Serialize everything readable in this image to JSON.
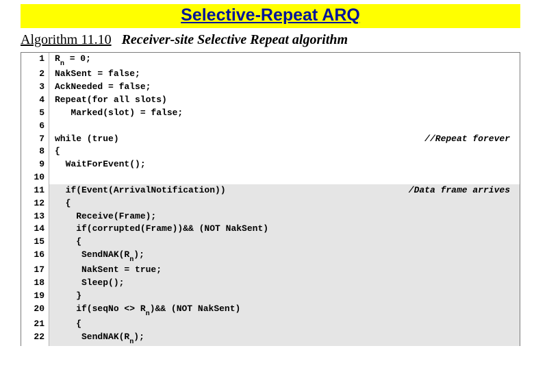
{
  "banner": {
    "title": "Selective-Repeat ARQ"
  },
  "heading": {
    "label": "Algorithm 11.10",
    "title": "Receiver-site Selective Repeat algorithm"
  },
  "code": {
    "lines": [
      {
        "n": "1",
        "bg": "a",
        "pre": "R",
        "sub": "n",
        "post": " = 0;",
        "comment": ""
      },
      {
        "n": "2",
        "bg": "a",
        "pre": "NakSent = false;",
        "sub": "",
        "post": "",
        "comment": ""
      },
      {
        "n": "3",
        "bg": "a",
        "pre": "AckNeeded = false;",
        "sub": "",
        "post": "",
        "comment": ""
      },
      {
        "n": "4",
        "bg": "a",
        "pre": "Repeat(for all slots)",
        "sub": "",
        "post": "",
        "comment": ""
      },
      {
        "n": "5",
        "bg": "a",
        "pre": "   Marked(slot) = false;",
        "sub": "",
        "post": "",
        "comment": ""
      },
      {
        "n": "6",
        "bg": "a",
        "pre": "",
        "sub": "",
        "post": "",
        "comment": ""
      },
      {
        "n": "7",
        "bg": "a",
        "pre": "while (true)",
        "sub": "",
        "post": "",
        "comment": "//Repeat forever"
      },
      {
        "n": "8",
        "bg": "a",
        "pre": "{",
        "sub": "",
        "post": "",
        "comment": ""
      },
      {
        "n": "9",
        "bg": "a",
        "pre": "  WaitForEvent();",
        "sub": "",
        "post": "",
        "comment": ""
      },
      {
        "n": "10",
        "bg": "a",
        "pre": "",
        "sub": "",
        "post": "",
        "comment": ""
      },
      {
        "n": "11",
        "bg": "b",
        "pre": "  if(Event(ArrivalNotification))",
        "sub": "",
        "post": "",
        "comment": "/Data frame arrives"
      },
      {
        "n": "12",
        "bg": "b",
        "pre": "  {",
        "sub": "",
        "post": "",
        "comment": ""
      },
      {
        "n": "13",
        "bg": "b",
        "pre": "    Receive(Frame);",
        "sub": "",
        "post": "",
        "comment": ""
      },
      {
        "n": "14",
        "bg": "b",
        "pre": "    if(corrupted(Frame))&& (NOT NakSent)",
        "sub": "",
        "post": "",
        "comment": ""
      },
      {
        "n": "15",
        "bg": "b",
        "pre": "    {",
        "sub": "",
        "post": "",
        "comment": ""
      },
      {
        "n": "16",
        "bg": "b",
        "pre": "     SendNAK(R",
        "sub": "n",
        "post": ");",
        "comment": ""
      },
      {
        "n": "17",
        "bg": "b",
        "pre": "     NakSent = true;",
        "sub": "",
        "post": "",
        "comment": ""
      },
      {
        "n": "18",
        "bg": "b",
        "pre": "     Sleep();",
        "sub": "",
        "post": "",
        "comment": ""
      },
      {
        "n": "19",
        "bg": "b",
        "pre": "    }",
        "sub": "",
        "post": "",
        "comment": ""
      },
      {
        "n": "20",
        "bg": "b",
        "pre": "    if(seqNo <> R",
        "sub": "n",
        "post": ")&& (NOT NakSent)",
        "comment": ""
      },
      {
        "n": "21",
        "bg": "b",
        "pre": "    {",
        "sub": "",
        "post": "",
        "comment": ""
      },
      {
        "n": "22",
        "bg": "b",
        "pre": "     SendNAK(R",
        "sub": "n",
        "post": ");",
        "comment": ""
      }
    ]
  }
}
